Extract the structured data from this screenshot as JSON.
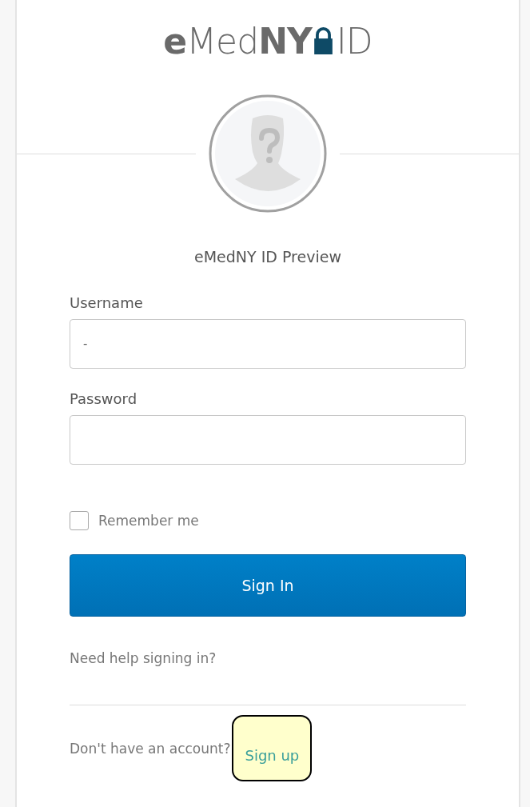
{
  "logo": [
    {
      "kind": "text",
      "text": "e",
      "bold": true
    },
    {
      "kind": "text",
      "text": "Med",
      "bold": false
    },
    {
      "kind": "text",
      "text": "NY",
      "bold": true
    },
    {
      "kind": "lock"
    },
    {
      "kind": "text",
      "text": "ID",
      "bold": false
    }
  ],
  "title": "eMedNY ID Preview",
  "fields": [
    {
      "label": "Username",
      "value": "-",
      "kind": "text"
    },
    {
      "label": "Password",
      "kind": "password"
    }
  ],
  "remember": {
    "label": "Remember me",
    "checked": false
  },
  "sign_in_button": "Sign In",
  "help_link": "Need help signing in?",
  "signup": {
    "prompt": "Don't have an account?",
    "link": "Sign up",
    "highlighted": true
  }
}
